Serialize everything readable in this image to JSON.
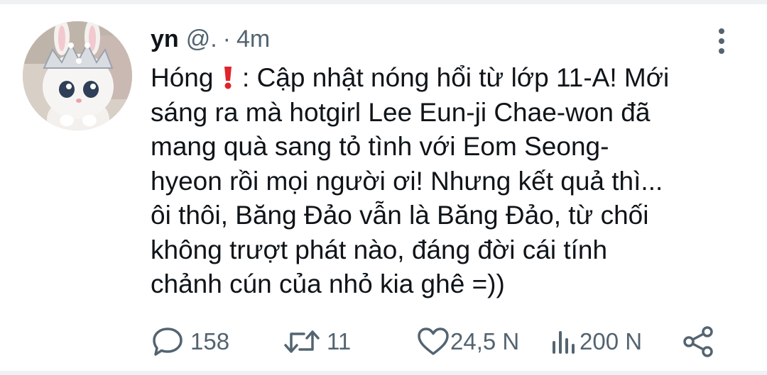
{
  "tweet": {
    "display_name": "yn",
    "handle": "@.",
    "separator": "·",
    "time": "4m",
    "text_lines": [
      "Hóng",
      ": Cập nhật nóng hổi từ lớp 11-A! Mới",
      "sáng ra mà hotgirl Lee Eun-ji Chae-won đã",
      "mang quà sang tỏ tình với Eom Seong-",
      "hyeon rồi mọi người ơi! Nhưng kết quả thì...",
      "ôi thôi, Băng Đảo vẫn là Băng Đảo, từ chối",
      "không trượt phát nào, đáng đời cái tính",
      "chảnh cún của nhỏ kia ghê =))"
    ],
    "emoji": "exclamation-mark-emoji"
  },
  "actions": {
    "replies": "158",
    "retweets": "11",
    "likes": "24,5 N",
    "views": "200 N"
  },
  "icons": {
    "reply": "reply-icon",
    "retweet": "retweet-icon",
    "like": "heart-icon",
    "views": "views-icon",
    "share": "share-icon",
    "more": "more-vertical-icon"
  },
  "colors": {
    "text": "#0f1419",
    "secondary": "#536471",
    "emoji_red": "#e0242b"
  }
}
